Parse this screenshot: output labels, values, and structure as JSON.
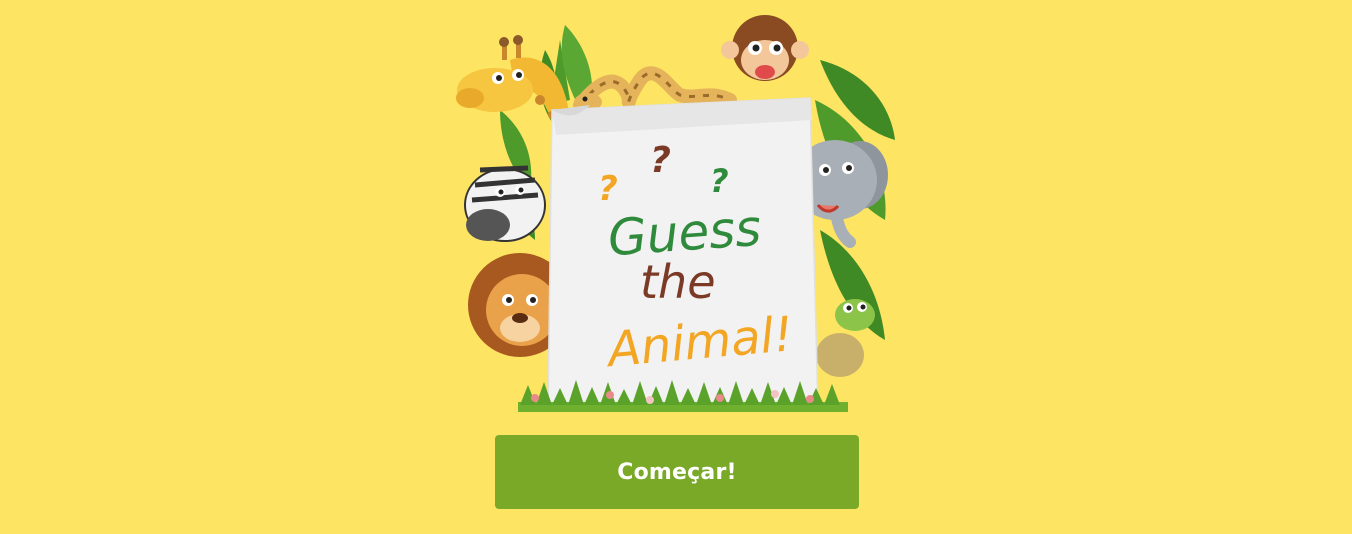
{
  "title_card": {
    "question_marks": [
      "?",
      "?",
      "?"
    ],
    "line1": "Guess",
    "line2": "the",
    "line3": "Animal!"
  },
  "characters": [
    "giraffe",
    "snake",
    "monkey",
    "zebra",
    "elephant",
    "lion",
    "turtle"
  ],
  "start_button": {
    "label": "Começar!"
  },
  "colors": {
    "background": "#fde463",
    "button": "#7aa928",
    "green_text": "#2f8a3c",
    "brown_text": "#7a3a26",
    "orange_text": "#f2a623"
  }
}
